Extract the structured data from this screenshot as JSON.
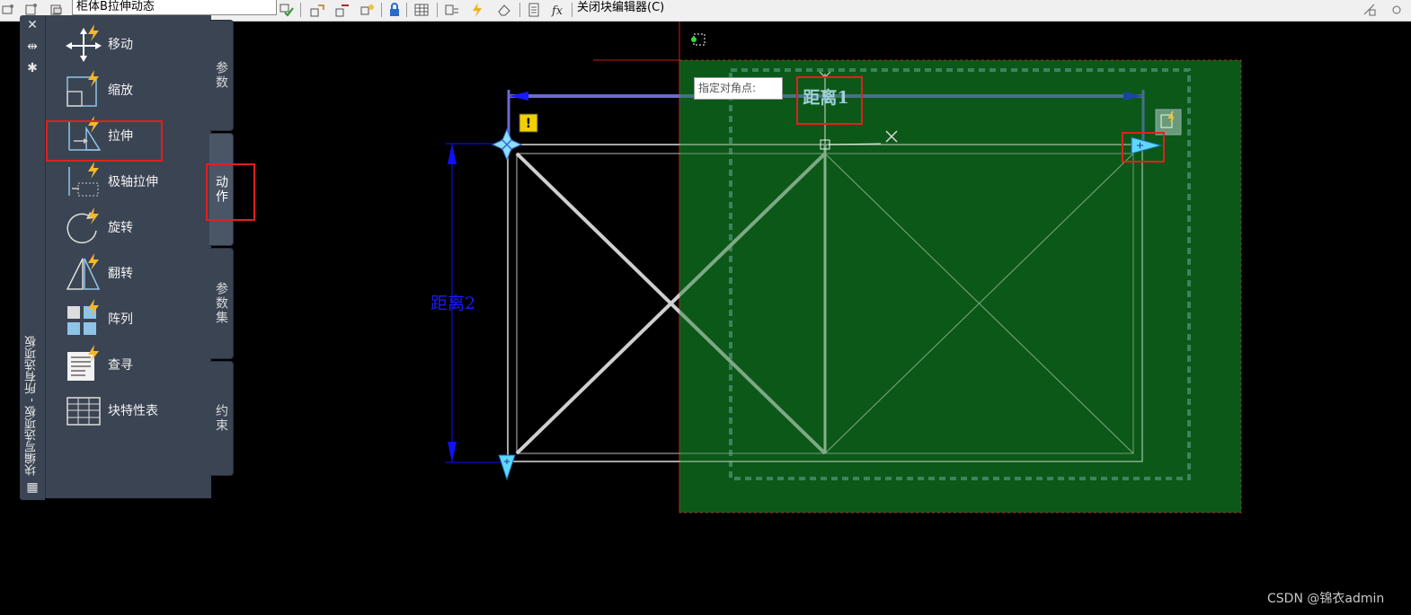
{
  "toolbar": {
    "block_name": "柜体B拉伸动态",
    "close_editor_label": "关闭块编辑器(C)"
  },
  "palette": {
    "title": "块编写选项板 - 所有选项板",
    "tools": [
      {
        "label": "移动",
        "icon": "move-action-icon"
      },
      {
        "label": "缩放",
        "icon": "scale-action-icon"
      },
      {
        "label": "拉伸",
        "icon": "stretch-action-icon"
      },
      {
        "label": "极轴拉伸",
        "icon": "polar-stretch-action-icon"
      },
      {
        "label": "旋转",
        "icon": "rotate-action-icon"
      },
      {
        "label": "翻转",
        "icon": "flip-action-icon"
      },
      {
        "label": "阵列",
        "icon": "array-action-icon"
      },
      {
        "label": "查寻",
        "icon": "lookup-action-icon"
      },
      {
        "label": "块特性表",
        "icon": "block-properties-table-icon"
      }
    ],
    "tabs": [
      {
        "label": "参数",
        "active": false
      },
      {
        "label": "动作",
        "active": true
      },
      {
        "label": "参数集",
        "active": false
      },
      {
        "label": "约束",
        "active": false
      }
    ]
  },
  "drawing": {
    "param_distance1": "距离1",
    "param_distance2": "距离2",
    "tooltip": "指定对角点:",
    "colors": {
      "selection_fill": "#003c0a",
      "crosshair": "#d01818",
      "dimension_blue": "#1010ff",
      "grip_cyan": "#5fd6ff",
      "highlight_red": "#e02020"
    }
  },
  "watermark": "CSDN @锦衣admin"
}
